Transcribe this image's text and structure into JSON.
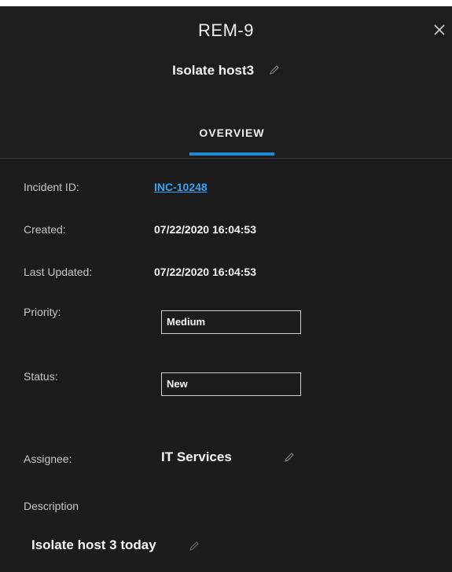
{
  "header": {
    "record_id": "REM-9",
    "title": "Isolate host3"
  },
  "tabs": [
    {
      "label": "OVERVIEW",
      "active": true
    }
  ],
  "fields": {
    "incident_id": {
      "label": "Incident ID:",
      "value": "INC-10248"
    },
    "created": {
      "label": "Created:",
      "value": "07/22/2020 16:04:53"
    },
    "last_updated": {
      "label": "Last Updated:",
      "value": "07/22/2020 16:04:53"
    },
    "priority": {
      "label": "Priority:",
      "value": "Medium"
    },
    "status": {
      "label": "Status:",
      "value": "New"
    },
    "assignee": {
      "label": "Assignee:",
      "value": "IT Services"
    },
    "description": {
      "label": "Description",
      "value": "Isolate host 3 today"
    }
  },
  "icons": {
    "close": "close-icon",
    "edit": "pencil-icon"
  },
  "colors": {
    "background": "#1c1c1c",
    "accent": "#1e8bd8",
    "link": "#3aa2f2"
  }
}
